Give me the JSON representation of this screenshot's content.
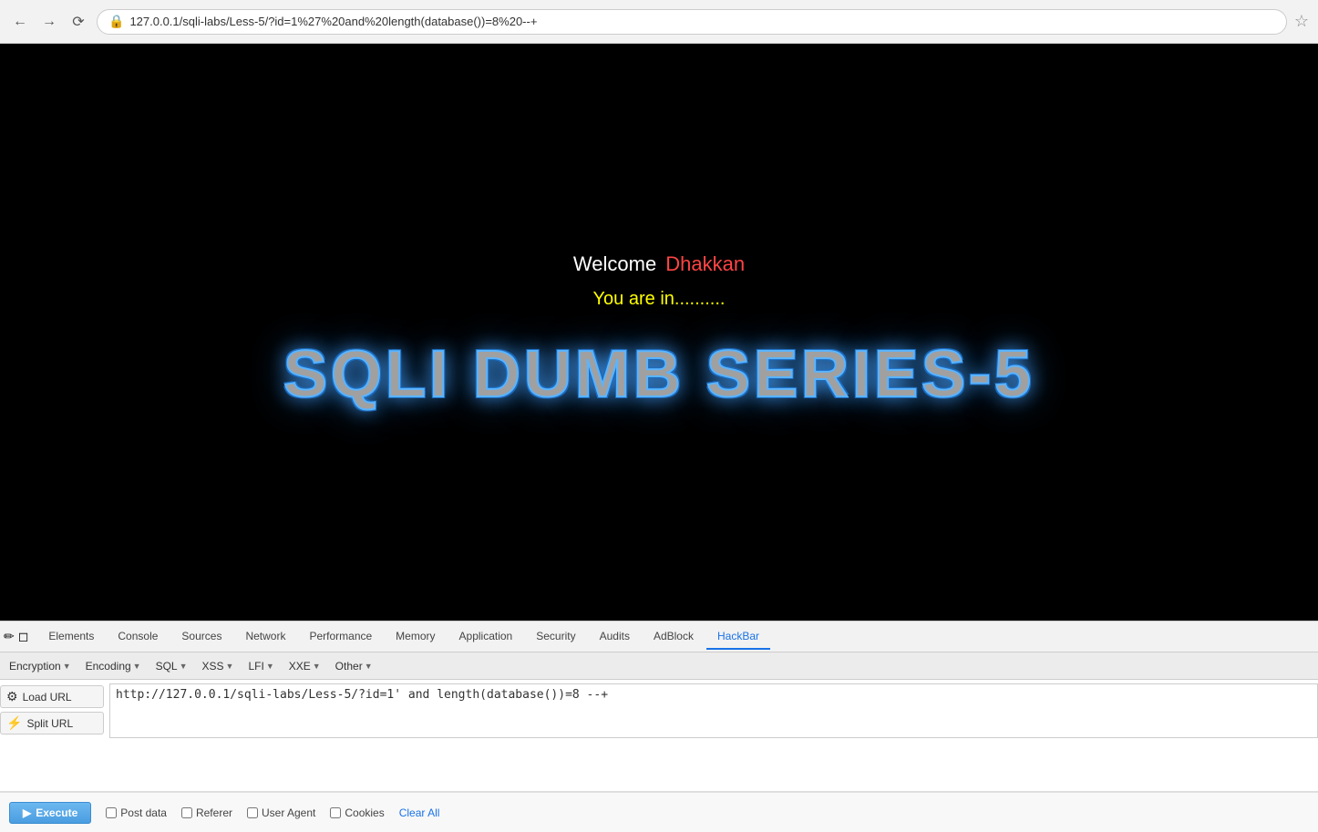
{
  "browser": {
    "url": "127.0.0.1/sqli-labs/Less-5/?id=1%27%20and%20length(database())=8%20--+",
    "url_display": "127.0.0.1/sqli-labs/Less-5/?id=1%27%20and%20length(database())=8%20--+"
  },
  "page": {
    "welcome_label": "Welcome",
    "welcome_name": "Dhakkan",
    "you_are_in": "You are in..........",
    "title": "SQLI DUMB SERIES-5"
  },
  "devtools": {
    "tabs": [
      {
        "label": "Elements",
        "active": false
      },
      {
        "label": "Console",
        "active": false
      },
      {
        "label": "Sources",
        "active": false
      },
      {
        "label": "Network",
        "active": false
      },
      {
        "label": "Performance",
        "active": false
      },
      {
        "label": "Memory",
        "active": false
      },
      {
        "label": "Application",
        "active": false
      },
      {
        "label": "Security",
        "active": false
      },
      {
        "label": "Audits",
        "active": false
      },
      {
        "label": "AdBlock",
        "active": false
      },
      {
        "label": "HackBar",
        "active": true
      }
    ]
  },
  "hackbar": {
    "menus": [
      {
        "label": "Encryption"
      },
      {
        "label": "Encoding"
      },
      {
        "label": "SQL"
      },
      {
        "label": "XSS"
      },
      {
        "label": "LFI"
      },
      {
        "label": "XXE"
      },
      {
        "label": "Other"
      }
    ],
    "load_url_label": "Load URL",
    "split_url_label": "Split URL",
    "execute_label": "Execute",
    "url_value": "http://127.0.0.1/sqli-labs/Less-5/?id=1' and length(database())=8 --+",
    "checkboxes": [
      {
        "label": "Post data",
        "checked": false
      },
      {
        "label": "Referer",
        "checked": false
      },
      {
        "label": "User Agent",
        "checked": false
      },
      {
        "label": "Cookies",
        "checked": false
      }
    ],
    "clear_all_label": "Clear All"
  }
}
